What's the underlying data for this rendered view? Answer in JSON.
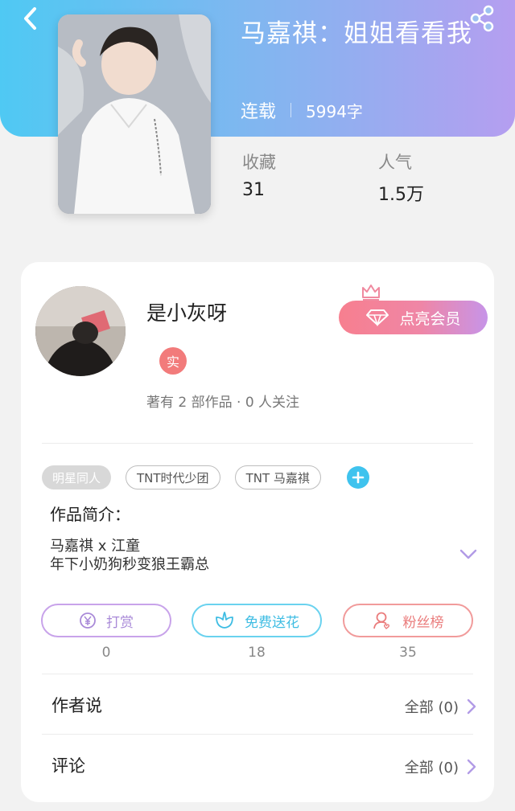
{
  "header": {
    "book_title": "马嘉祺：姐姐看看我",
    "status": "连载",
    "word_count": "5994字",
    "stats": {
      "favorites_label": "收藏",
      "favorites_value": "31",
      "popularity_label": "人气",
      "popularity_value": "1.5万"
    }
  },
  "author": {
    "name": "是小灰呀",
    "verified_badge": "实",
    "summary": "著有 2 部作品 · 0 人关注",
    "vip_label": "点亮会员"
  },
  "tags": [
    "明星同人",
    "TNT时代少团",
    "TNT 马嘉祺"
  ],
  "intro": {
    "title": "作品简介：",
    "line1": "马嘉祺 x 江童",
    "line2": "年下小奶狗秒变狼王霸总"
  },
  "actions": {
    "tip_label": "打赏",
    "tip_count": "0",
    "flower_label": "免费送花",
    "flower_count": "18",
    "fans_label": "粉丝榜",
    "fans_count": "35"
  },
  "sections": {
    "author_says_title": "作者说",
    "author_says_link": "全部 (0)",
    "comments_title": "评论",
    "comments_link": "全部 (0)"
  },
  "colors": {
    "header_gradient_start": "#4fc9f3",
    "header_gradient_end": "#b59ef0",
    "accent_blue": "#3fc3ee",
    "vip_pink": "#f77f8f",
    "tip_purple": "#a98ad8",
    "fans_red": "#ea7c7c"
  },
  "icons": [
    "back-arrow-icon",
    "share-icon",
    "crown-icon",
    "diamond-icon",
    "yen-coin-icon",
    "flower-icon",
    "fans-user-icon",
    "plus-icon",
    "chevron-down-icon",
    "chevron-right-icon"
  ]
}
